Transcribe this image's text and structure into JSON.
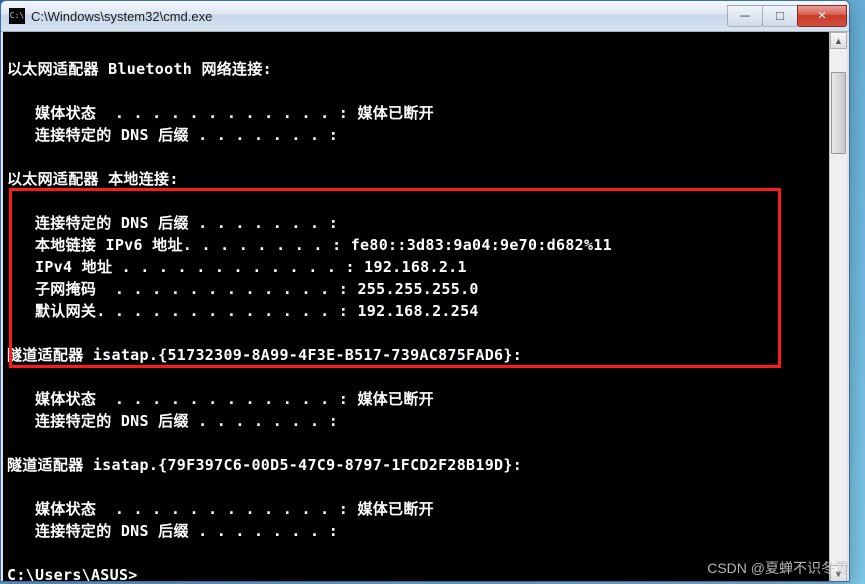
{
  "titlebar": {
    "path": "C:\\Windows\\system32\\cmd.exe"
  },
  "controls": {
    "min": "─",
    "max": "□",
    "close": "×"
  },
  "terminal": {
    "sections": [
      {
        "header": "以太网适配器 Bluetooth 网络连接:",
        "rows": [
          {
            "label": "媒体状态",
            "dots": "  . . . . . . . . . . . . ",
            "value": "媒体已断开"
          },
          {
            "label": "连接特定的 DNS 后缀",
            "dots": " . . . . . . . ",
            "value": ""
          }
        ]
      },
      {
        "header": "以太网适配器 本地连接:",
        "rows": [
          {
            "label": "连接特定的 DNS 后缀",
            "dots": " . . . . . . . ",
            "value": ""
          },
          {
            "label": "本地链接 IPv6 地址",
            "dots": ". . . . . . . . ",
            "value": "fe80::3d83:9a04:9e70:d682%11"
          },
          {
            "label": "IPv4 地址",
            "dots": " . . . . . . . . . . . . ",
            "value": "192.168.2.1"
          },
          {
            "label": "子网掩码",
            "dots": "  . . . . . . . . . . . . ",
            "value": "255.255.255.0"
          },
          {
            "label": "默认网关",
            "dots": ". . . . . . . . . . . . . ",
            "value": "192.168.2.254"
          }
        ]
      },
      {
        "header": "隧道适配器 isatap.{51732309-8A99-4F3E-B517-739AC875FAD6}:",
        "rows": [
          {
            "label": "媒体状态",
            "dots": "  . . . . . . . . . . . . ",
            "value": "媒体已断开"
          },
          {
            "label": "连接特定的 DNS 后缀",
            "dots": " . . . . . . . ",
            "value": ""
          }
        ]
      },
      {
        "header": "隧道适配器 isatap.{79F397C6-00D5-47C9-8797-1FCD2F28B19D}:",
        "rows": [
          {
            "label": "媒体状态",
            "dots": "  . . . . . . . . . . . . ",
            "value": "媒体已断开"
          },
          {
            "label": "连接特定的 DNS 后缀",
            "dots": " . . . . . . . ",
            "value": ""
          }
        ]
      }
    ],
    "prompt": "C:\\Users\\ASUS>"
  },
  "watermark": "CSDN @夏蝉不识冬雪"
}
